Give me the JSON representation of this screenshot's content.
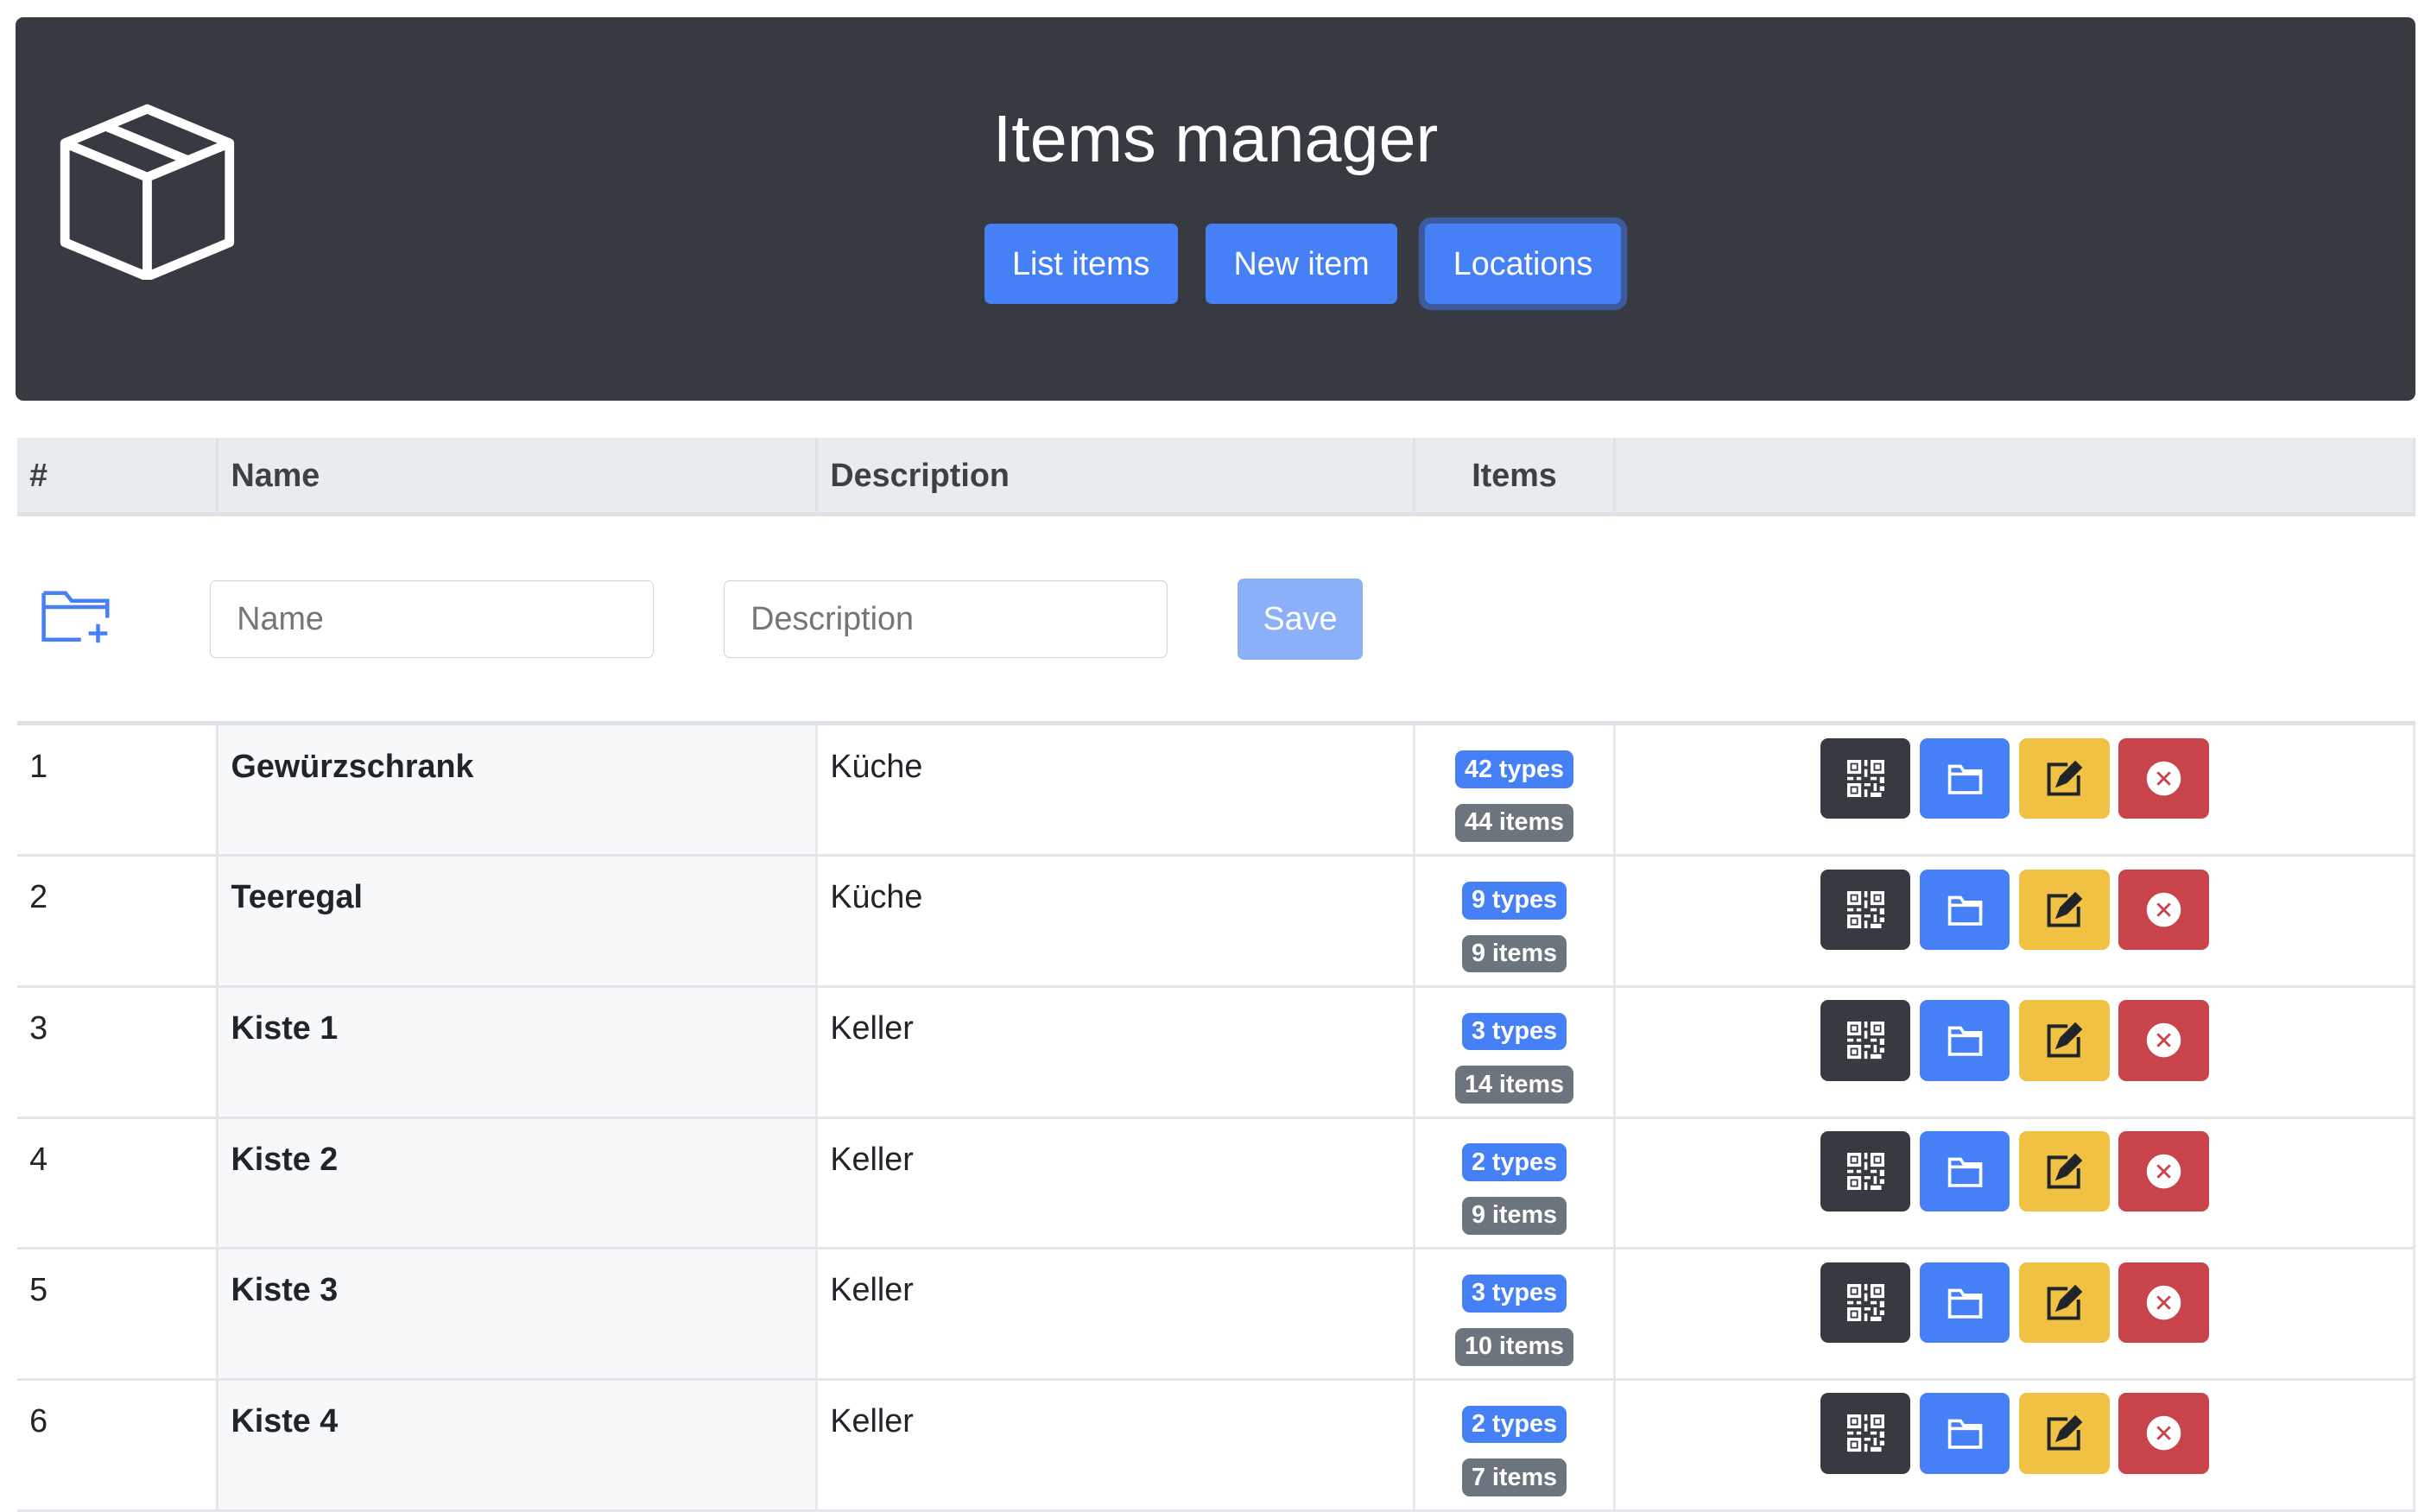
{
  "header": {
    "title": "Items manager",
    "nav": [
      {
        "label": "List items"
      },
      {
        "label": "New item"
      },
      {
        "label": "Locations"
      }
    ]
  },
  "table": {
    "columns": [
      "#",
      "Name",
      "Description",
      "Items",
      ""
    ],
    "form": {
      "name_placeholder": "Name",
      "description_placeholder": "Description",
      "save_label": "Save"
    },
    "rows": [
      {
        "id": "1",
        "name": "Gewürzschrank",
        "description": "Küche",
        "types": "42 types",
        "items": "44 items"
      },
      {
        "id": "2",
        "name": "Teeregal",
        "description": "Küche",
        "types": "9 types",
        "items": "9 items"
      },
      {
        "id": "3",
        "name": "Kiste 1",
        "description": "Keller",
        "types": "3 types",
        "items": "14 items"
      },
      {
        "id": "4",
        "name": "Kiste 2",
        "description": "Keller",
        "types": "2 types",
        "items": "9 items"
      },
      {
        "id": "5",
        "name": "Kiste 3",
        "description": "Keller",
        "types": "3 types",
        "items": "10 items"
      },
      {
        "id": "6",
        "name": "Kiste 4",
        "description": "Keller",
        "types": "2 types",
        "items": "7 items"
      }
    ]
  }
}
